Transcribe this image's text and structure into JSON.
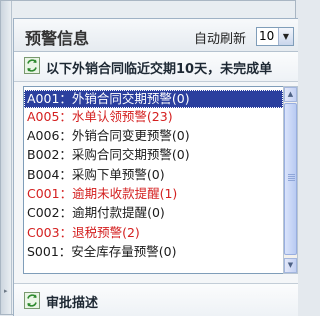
{
  "panel": {
    "title": "预警信息",
    "refresh_label": "自动刷新",
    "refresh_interval": "10",
    "notice": "以下外销合同临近交期10天，未完成单"
  },
  "alerts": [
    {
      "text": "A001：外销合同交期预警(0)",
      "color": "#ffffff",
      "selected": true
    },
    {
      "text": "A005：水单认领预警(23)",
      "color": "#d42020",
      "selected": false
    },
    {
      "text": "A006：外销合同变更预警(0)",
      "color": "#1a1a1a",
      "selected": false
    },
    {
      "text": "B002：采购合同交期预警(0)",
      "color": "#1a1a1a",
      "selected": false
    },
    {
      "text": "B004：采购下单预警(0)",
      "color": "#1a1a1a",
      "selected": false
    },
    {
      "text": "C001：逾期未收款提醒(1)",
      "color": "#d42020",
      "selected": false
    },
    {
      "text": "C002：逾期付款提醒(0)",
      "color": "#1a1a1a",
      "selected": false
    },
    {
      "text": "C003：退税预警(2)",
      "color": "#d42020",
      "selected": false
    },
    {
      "text": "S001：安全库存量预警(0)",
      "color": "#1a1a1a",
      "selected": false
    }
  ],
  "approval": {
    "label": "审批描述"
  },
  "colors": {
    "selection": "#2b3f9e",
    "alert_red": "#d42020"
  }
}
